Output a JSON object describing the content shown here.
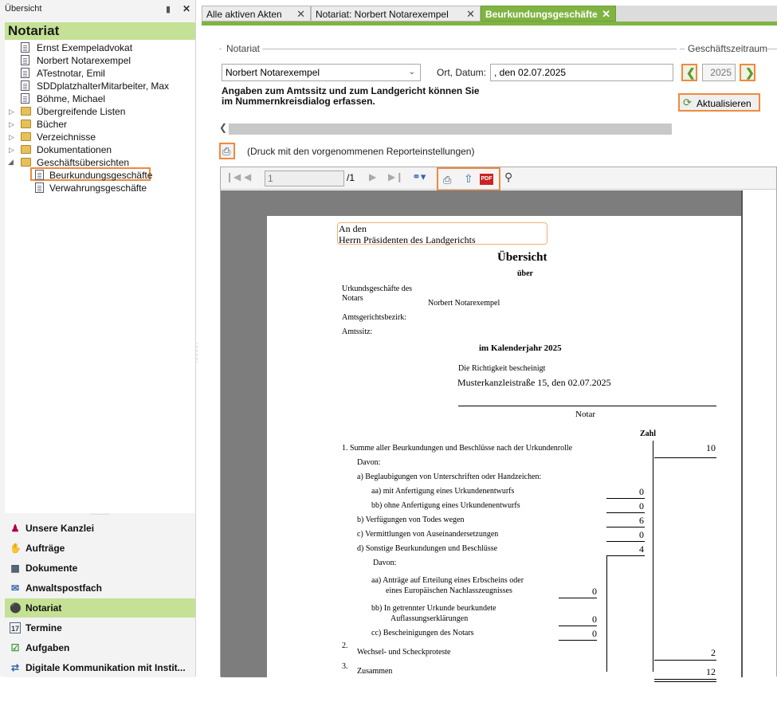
{
  "left_panel": {
    "header": "Übersicht",
    "section_title": "Notariat",
    "tree": [
      {
        "label": "Ernst Exempeladvokat"
      },
      {
        "label": "Norbert Notarexempel"
      },
      {
        "label": "ATestnotar, Emil"
      },
      {
        "label": "SDDplatzhalterMitarbeiter, Max"
      },
      {
        "label": "Böhme, Michael"
      },
      {
        "label": "Übergreifende Listen"
      },
      {
        "label": "Bücher"
      },
      {
        "label": "Verzeichnisse"
      },
      {
        "label": "Dokumentationen"
      },
      {
        "label": "Geschäftsübersichten"
      },
      {
        "label": "Beurkundungsgeschäfte"
      },
      {
        "label": "Verwahrungsgeschäfte"
      }
    ],
    "nav": [
      {
        "label": "Unsere Kanzlei"
      },
      {
        "label": "Aufträge"
      },
      {
        "label": "Dokumente"
      },
      {
        "label": "Anwaltspostfach"
      },
      {
        "label": "Notariat"
      },
      {
        "label": "Termine"
      },
      {
        "label": "Aufgaben"
      },
      {
        "label": "Digitale Kommunikation mit Instit..."
      }
    ]
  },
  "tabs": [
    {
      "label": "Alle aktiven Akten"
    },
    {
      "label": "Notariat: Norbert Notarexempel"
    },
    {
      "label": "Beurkundungsgeschäfte"
    }
  ],
  "form": {
    "notariat_label": "Notariat",
    "notar_value": "Norbert Notarexempel",
    "ort_label": "Ort, Datum:",
    "ort_value": ", den 02.07.2025",
    "zeitraum_label": "Geschäftszeitraum",
    "year": "2025",
    "info": "Angaben zum Amtssitz und zum Landgericht können Sie im Nummernkreisdialog erfassen.",
    "refresh_label": "Aktualisieren",
    "print_hint": "(Druck mit den vorgenommenen Reporteinstellungen)"
  },
  "viewer": {
    "page_value": "1",
    "page_total": "/1"
  },
  "report": {
    "addr1": "An den",
    "addr2": "Herrn Präsidenten des Landgerichts",
    "title": "Übersicht",
    "sub": "über",
    "l1": "Urkundsgeschäfte des",
    "l1b": "Notars",
    "notar": "Norbert Notarexempel",
    "l2": "Amtsgerichtsbezirk:",
    "l3": "Amtssitz:",
    "year_line": "im Kalenderjahr 2025",
    "richtig": "Die Richtigkeit bescheinigt",
    "ort": "Musterkanzleistraße 15, den 02.07.2025",
    "notar_sig": "Notar",
    "zahl": "Zahl",
    "r1": "1.  Summe aller Beurkundungen und Beschlüsse nach der Urkundenrolle",
    "r1v": "10",
    "davon": "Davon:",
    "ra": "a)   Beglaubigungen von Unterschriften oder Handzeichen:",
    "raa": "aa)  mit Anfertigung eines Urkundenentwurfs",
    "raav": "0",
    "rbb": "bb)  ohne Anfertigung eines Urkundenentwurfs",
    "rbbv": "0",
    "rb": "b)   Verfügungen von Todes wegen",
    "rbv": "6",
    "rc": "c)   Vermittlungen von Auseinandersetzungen",
    "rcv": "0",
    "rd": "d)   Sonstige Beurkundungen und Beschlüsse",
    "rdv": "4",
    "davon2": "Davon:",
    "daa1": "aa)  Anträge auf Erteilung eines Erbscheins oder",
    "daa2": "eines Europäischen Nachlasszeugnisses",
    "daav": "0",
    "dbb1": "bb)    In getrennter Urkunde beurkundete",
    "dbb2": "Auflassungserklärungen",
    "dbbv": "0",
    "dcc": "cc)    Bescheinigungen des Notars",
    "dccv": "0",
    "n2": "2.",
    "r2": "Wechsel- und Scheckproteste",
    "r2v": "2",
    "n3": "3.",
    "r3": "Zusammen",
    "r3v": "12"
  }
}
